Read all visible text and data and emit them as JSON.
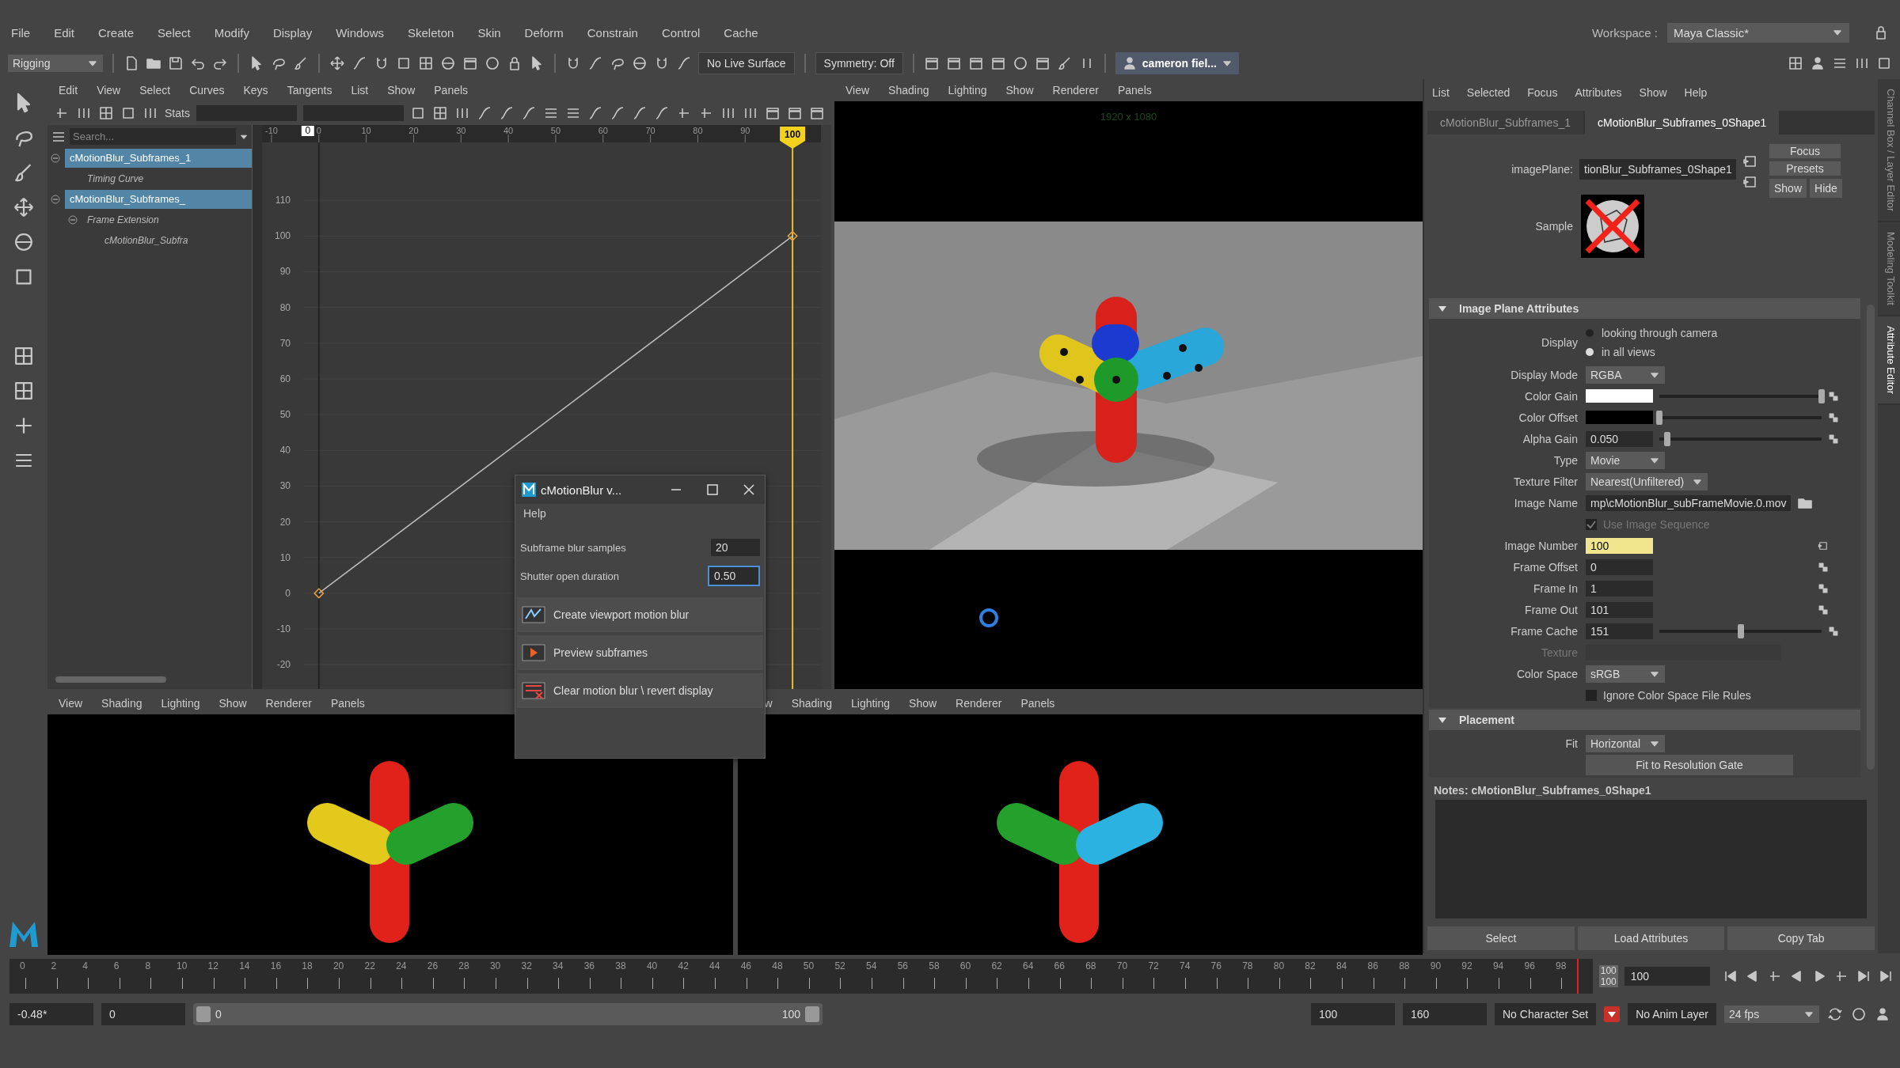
{
  "menu_bar": [
    "File",
    "Edit",
    "Create",
    "Select",
    "Modify",
    "Display",
    "Windows",
    "Skeleton",
    "Skin",
    "Deform",
    "Constrain",
    "Control",
    "Cache"
  ],
  "workspace": {
    "label": "Workspace :",
    "value": "Maya Classic*"
  },
  "toolbar": {
    "menu_set": "Rigging",
    "live_surface": "No Live Surface",
    "symmetry": "Symmetry: Off",
    "user": "cameron fiel..."
  },
  "graph_editor": {
    "menu": [
      "Edit",
      "View",
      "Select",
      "Curves",
      "Keys",
      "Tangents",
      "List",
      "Show",
      "Panels"
    ],
    "stats_label": "Stats",
    "outliner": {
      "search_placeholder": "Search...",
      "items": [
        {
          "label": "cMotionBlur_Subframes_1",
          "selected": true,
          "expanded": true,
          "children": [
            {
              "label": "Timing Curve",
              "selected": false
            }
          ]
        },
        {
          "label": "cMotionBlur_Subframes_",
          "selected": true,
          "expanded": true,
          "children": [
            {
              "label": "Frame Extension",
              "selected": false,
              "expanded": true,
              "children": [
                {
                  "label": "cMotionBlur_Subfra",
                  "selected": false
                }
              ]
            }
          ]
        }
      ]
    },
    "range_start_marker": "0",
    "current_frame": "100",
    "chart_data": {
      "type": "line",
      "x": [
        0,
        100
      ],
      "series": [
        {
          "color": "#bdbdbd",
          "marker": "diamond",
          "values": [
            0,
            100
          ]
        }
      ],
      "xlim": [
        -12,
        106
      ],
      "ylim": [
        -27.7,
        126.2
      ],
      "grid": true,
      "ref_lines": [
        {
          "axis": "x",
          "value": 0,
          "color": "#222222"
        },
        {
          "axis": "x",
          "value": 100,
          "color": "#e8c02a"
        }
      ],
      "xticks": [
        -10,
        0,
        10,
        20,
        30,
        40,
        50,
        60,
        70,
        80,
        90
      ],
      "yticks": [
        110,
        100,
        90,
        80,
        70,
        60,
        50,
        40,
        30,
        20,
        10,
        0,
        -10,
        -20
      ]
    }
  },
  "viewports": [
    {
      "kind": "perspective",
      "menu": [
        "View",
        "Shading",
        "Lighting",
        "Show",
        "Renderer",
        "Panels"
      ],
      "resolution": "1920 x 1080"
    },
    {
      "kind": "front",
      "menu": [
        "View",
        "Shading",
        "Lighting",
        "Show",
        "Renderer",
        "Panels"
      ]
    },
    {
      "kind": "side",
      "menu": [
        "w",
        "Shading",
        "Lighting",
        "Show",
        "Renderer",
        "Panels"
      ]
    }
  ],
  "dialog": {
    "title": "cMotionBlur v...",
    "menu": [
      "Help"
    ],
    "fields": [
      {
        "label": "Subframe blur samples",
        "value": "20",
        "focused": false
      },
      {
        "label": "Shutter open duration",
        "value": "0.50",
        "focused": true
      }
    ],
    "actions": [
      "Create viewport motion blur",
      "Preview subframes",
      "Clear motion blur \\ revert display"
    ]
  },
  "attribute_editor": {
    "menu": [
      "List",
      "Selected",
      "Focus",
      "Attributes",
      "Show",
      "Help"
    ],
    "tabs": [
      {
        "label": "cMotionBlur_Subframes_1",
        "selected": false
      },
      {
        "label": "cMotionBlur_Subframes_0Shape1",
        "selected": true
      }
    ],
    "node_field": {
      "label": "imagePlane:",
      "value": "tionBlur_Subframes_0Shape1"
    },
    "side_buttons": [
      "Focus",
      "Presets",
      "Show",
      "Hide"
    ],
    "sample_label": "Sample",
    "sections": [
      {
        "title": "Image Plane Attributes",
        "expanded": true,
        "rows": [
          {
            "kind": "radio",
            "label": "Display",
            "options": [
              {
                "label": "looking through camera",
                "selected": false
              },
              {
                "label": "in all views",
                "selected": true
              }
            ]
          },
          {
            "kind": "dropdown",
            "label": "Display Mode",
            "value": "RGBA"
          },
          {
            "kind": "color",
            "label": "Color Gain",
            "color": "#ffffff",
            "level": 1
          },
          {
            "kind": "color",
            "label": "Color Offset",
            "color": "#000000",
            "level": 0
          },
          {
            "kind": "slider",
            "label": "Alpha Gain",
            "value": "0.050",
            "level": 0.05
          },
          {
            "kind": "dropdown",
            "label": "Type",
            "value": "Movie"
          },
          {
            "kind": "dropdown",
            "label": "Texture Filter",
            "value": "Nearest(Unfiltered)"
          },
          {
            "kind": "file",
            "label": "Image Name",
            "value": "mp\\cMotionBlur_subFrameMovie.0.mov"
          },
          {
            "kind": "checkbox",
            "label": "Use Image Sequence",
            "checked": true,
            "disabled": true
          },
          {
            "kind": "field",
            "label": "Image Number",
            "value": "100",
            "keyed": true
          },
          {
            "kind": "field",
            "label": "Frame Offset",
            "value": "0",
            "keyed": false
          },
          {
            "kind": "field",
            "label": "Frame In",
            "value": "1",
            "keyed": false
          },
          {
            "kind": "field",
            "label": "Frame Out",
            "value": "101",
            "keyed": false
          },
          {
            "kind": "slider",
            "label": "Frame Cache",
            "value": "151",
            "level": 0.5
          },
          {
            "kind": "texture",
            "label": "Texture",
            "disabled": true
          },
          {
            "kind": "dropdown",
            "label": "Color Space",
            "value": "sRGB"
          },
          {
            "kind": "checkbox",
            "label": "Ignore Color Space File Rules",
            "checked": false,
            "disabled": false
          }
        ]
      },
      {
        "title": "Placement",
        "expanded": true,
        "rows": [
          {
            "kind": "dropdown",
            "label": "Fit",
            "value": "Horizontal"
          },
          {
            "kind": "button",
            "label": "Fit to Resolution Gate"
          }
        ]
      }
    ],
    "notes": "Notes:  cMotionBlur_Subframes_0Shape1",
    "buttons": [
      "Select",
      "Load Attributes",
      "Copy Tab"
    ]
  },
  "side_tabs": [
    {
      "label": "Channel Box / Layer Editor",
      "selected": false
    },
    {
      "label": "Modeling Toolkit",
      "selected": false
    },
    {
      "label": "Attribute Editor",
      "selected": true
    }
  ],
  "time_slider": {
    "ticks": [
      "0",
      "2",
      "4",
      "6",
      "8",
      "10",
      "12",
      "14",
      "16",
      "18",
      "20",
      "22",
      "24",
      "26",
      "28",
      "30",
      "32",
      "34",
      "36",
      "38",
      "40",
      "42",
      "44",
      "46",
      "48",
      "50",
      "52",
      "54",
      "56",
      "58",
      "60",
      "62",
      "64",
      "66",
      "68",
      "70",
      "72",
      "74",
      "76",
      "78",
      "80",
      "82",
      "84",
      "86",
      "88",
      "90",
      "92",
      "94",
      "96",
      "98"
    ],
    "end_labels": [
      "100",
      "100"
    ],
    "playhead": {
      "level": 0.98
    },
    "current_field": "100"
  },
  "range_bar": {
    "start": "-0.48*",
    "anim_start": "0",
    "range_start": "0",
    "range_end": "100",
    "level": 1,
    "playback_end": "100",
    "anim_end": "160",
    "character_set": "No Character Set",
    "anim_layer": "No Anim Layer",
    "fps": "24 fps"
  }
}
